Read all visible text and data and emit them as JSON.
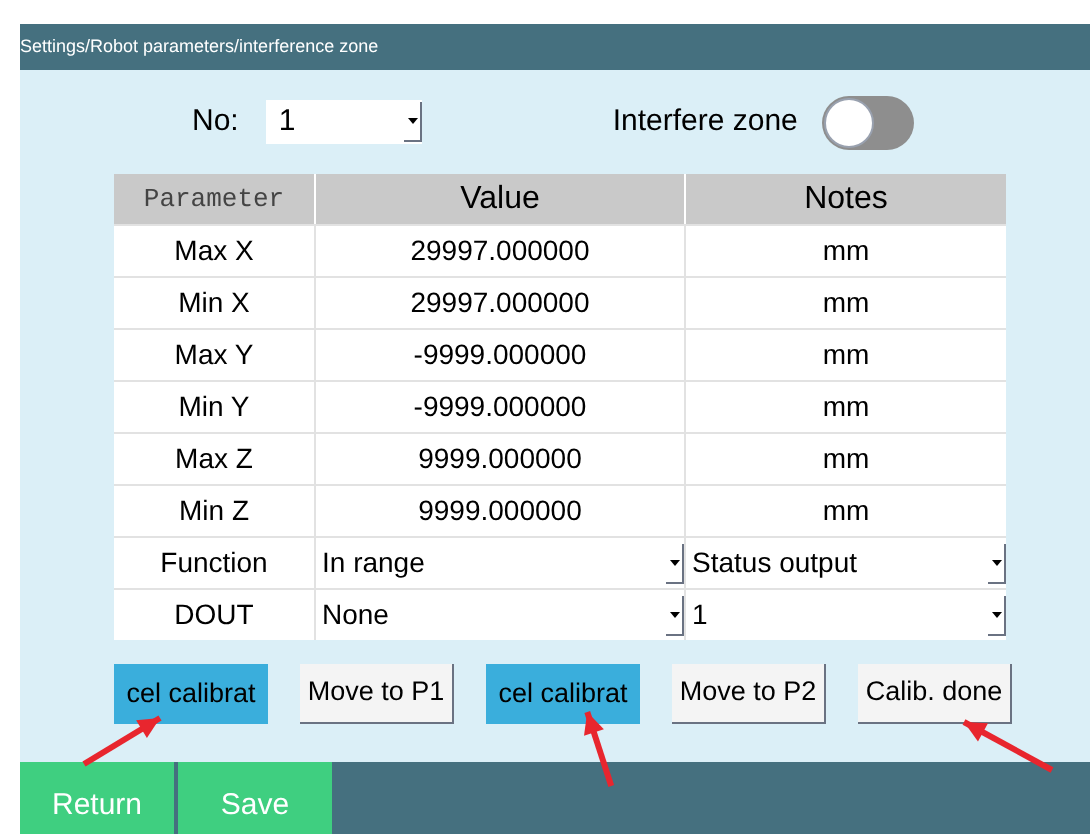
{
  "breadcrumb": "Settings/Robot parameters/interference zone",
  "no_field": {
    "label": "No:",
    "value": "1"
  },
  "interfere_zone": {
    "label": "Interfere zone",
    "on": false
  },
  "table": {
    "columns": [
      "Parameter",
      "Value",
      "Notes"
    ],
    "rows": [
      {
        "kind": "text",
        "cells": [
          "Max X",
          "29997.000000",
          "mm"
        ]
      },
      {
        "kind": "text",
        "cells": [
          "Min X",
          "29997.000000",
          "mm"
        ]
      },
      {
        "kind": "text",
        "cells": [
          "Max Y",
          "-9999.000000",
          "mm"
        ]
      },
      {
        "kind": "text",
        "cells": [
          "Min Y",
          "-9999.000000",
          "mm"
        ]
      },
      {
        "kind": "text",
        "cells": [
          "Max Z",
          "9999.000000",
          "mm"
        ]
      },
      {
        "kind": "text",
        "cells": [
          "Min Z",
          "9999.000000",
          "mm"
        ]
      },
      {
        "kind": "select",
        "cells": [
          "Function",
          "In range",
          "Status output"
        ]
      },
      {
        "kind": "select",
        "cells": [
          "DOUT",
          "None",
          "1"
        ]
      }
    ]
  },
  "actions": [
    {
      "label": "cel calibrat",
      "selected": true
    },
    {
      "label": "Move to P1",
      "selected": false
    },
    {
      "label": "cel calibrat",
      "selected": true
    },
    {
      "label": "Move to P2",
      "selected": false
    },
    {
      "label": "Calib. done",
      "selected": false
    }
  ],
  "footer_buttons": [
    "Return",
    "Save"
  ]
}
